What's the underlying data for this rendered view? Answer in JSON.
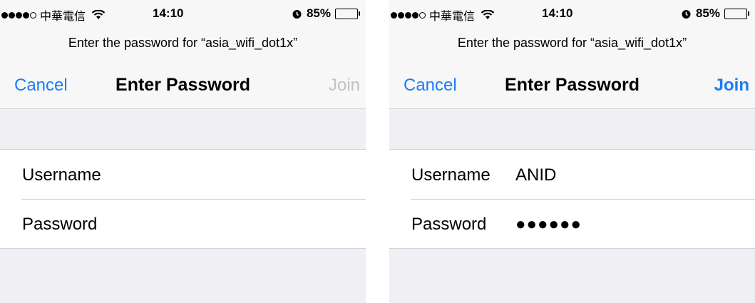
{
  "screens": [
    {
      "status": {
        "carrier": "中華電信",
        "time": "14:10",
        "battery": "85%",
        "battery_level": 0.85
      },
      "prompt": "Enter the password for “asia_wifi_dot1x”",
      "nav": {
        "cancel": "Cancel",
        "title": "Enter Password",
        "join": "Join",
        "join_enabled": false
      },
      "fields": {
        "username_label": "Username",
        "username_value": "",
        "password_label": "Password",
        "password_value": ""
      }
    },
    {
      "status": {
        "carrier": "中華電信",
        "time": "14:10",
        "battery": "85%",
        "battery_level": 0.85
      },
      "prompt": "Enter the password for “asia_wifi_dot1x”",
      "nav": {
        "cancel": "Cancel",
        "title": "Enter Password",
        "join": "Join",
        "join_enabled": true
      },
      "fields": {
        "username_label": "Username",
        "username_value": "ANID",
        "password_label": "Password",
        "password_value": "●●●●●●"
      }
    }
  ],
  "colors": {
    "accent": "#1b7cf5",
    "disabled": "#c2c2c6",
    "background": "#efeff4"
  },
  "icons": [
    "signal-dots-icon",
    "wifi-icon",
    "alarm-icon",
    "battery-icon"
  ]
}
